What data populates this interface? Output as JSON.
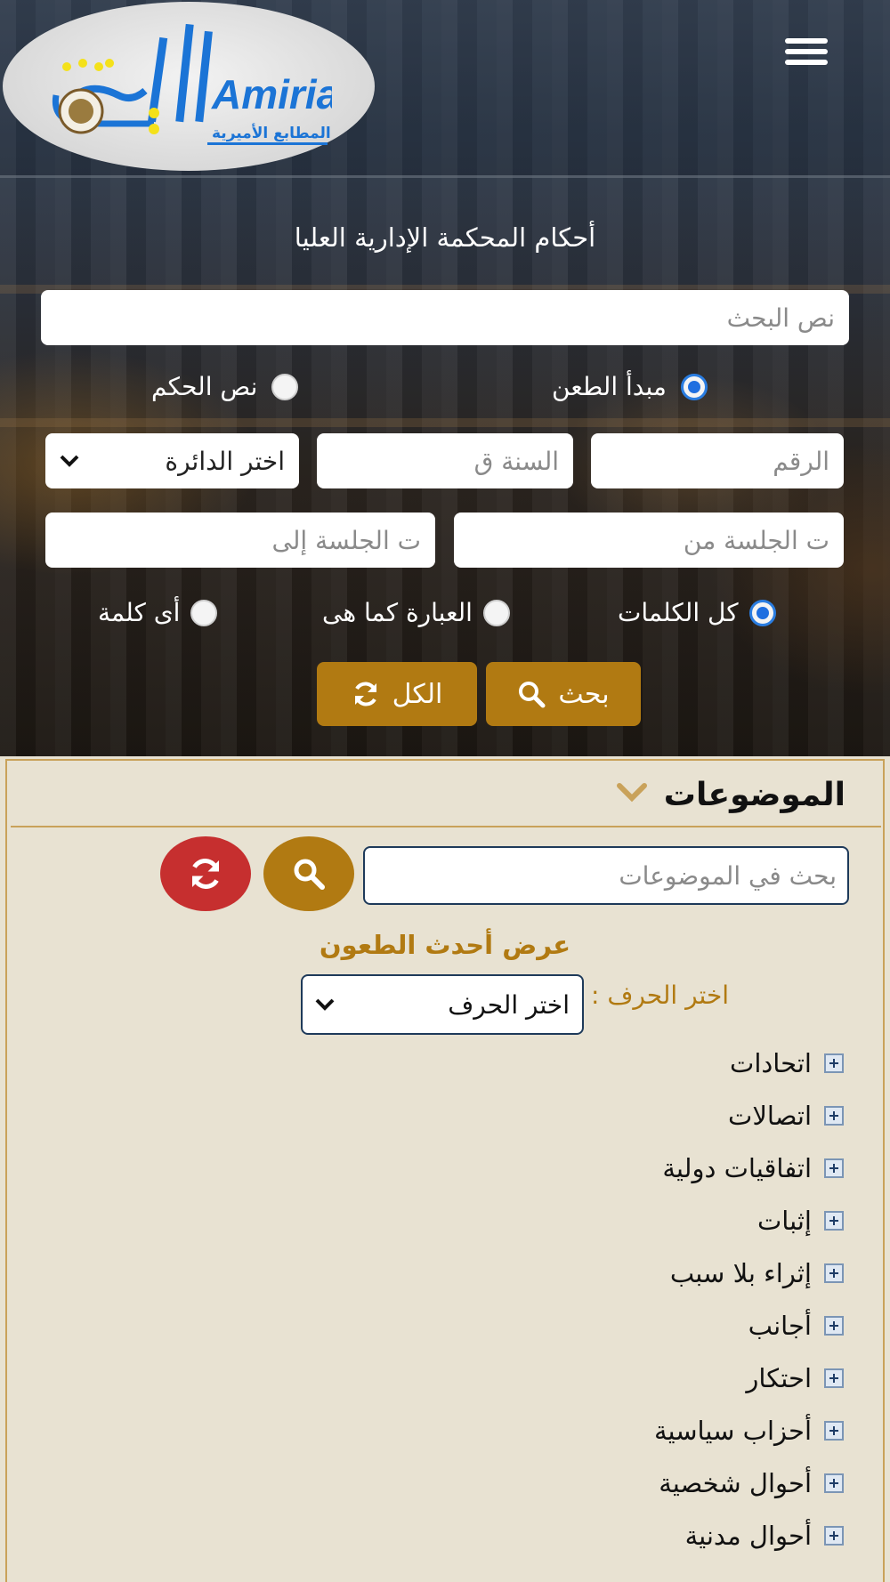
{
  "header": {
    "logo_text": "Amiria",
    "logo_subtitle": "المطابع الأميرية"
  },
  "search_form": {
    "title": "أحكام المحكمة الإدارية العليا",
    "search_text_placeholder": "نص البحث",
    "scope_options": [
      {
        "label": "مبدأ الطعن",
        "selected": true
      },
      {
        "label": "نص الحكم",
        "selected": false
      }
    ],
    "number_placeholder": "الرقم",
    "year_placeholder": "السنة ق",
    "circuit_select": "اختر الدائرة",
    "session_from_placeholder": "ت الجلسة من",
    "session_to_placeholder": "ت الجلسة إلى",
    "match_options": [
      {
        "label": "كل الكلمات",
        "selected": true
      },
      {
        "label": "العبارة كما هى",
        "selected": false
      },
      {
        "label": "أى كلمة",
        "selected": false
      }
    ],
    "search_button": "بحث",
    "reset_button": "الكل"
  },
  "topics": {
    "title": "الموضوعات",
    "search_placeholder": "بحث في الموضوعات",
    "latest_link": "عرض أحدث الطعون",
    "letter_label": "اختر الحرف :",
    "letter_select": "اختر الحرف",
    "items": [
      "اتحادات",
      "اتصالات",
      "اتفاقيات دولية",
      "إثبات",
      "إثراء بلا سبب",
      "أجانب",
      "احتكار",
      "أحزاب سياسية",
      "أحوال شخصية",
      "أحوال مدنية"
    ]
  },
  "colors": {
    "gold": "#b17a12",
    "red": "#c62f2f",
    "panel_bg": "#e8e2d2",
    "radio_blue": "#1f6fe0"
  }
}
